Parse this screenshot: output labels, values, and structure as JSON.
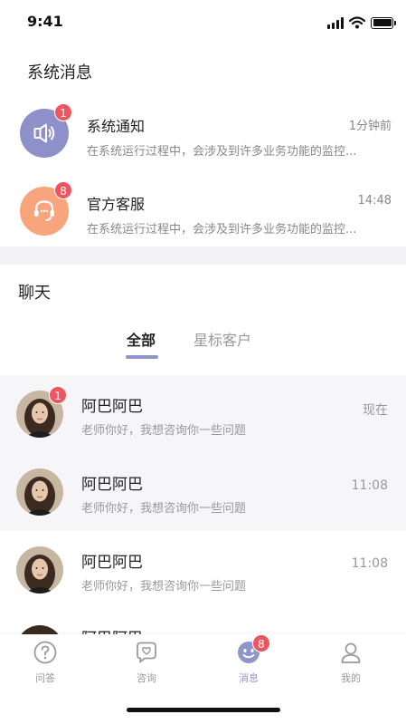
{
  "status_bar": {
    "time": "9:41",
    "icons": [
      "signal-icon",
      "wifi-icon",
      "battery-icon"
    ]
  },
  "system_section": {
    "title": "系统消息",
    "items": [
      {
        "name": "系统通知",
        "time": "1分钟前",
        "preview": "在系统运行过程中，会涉及到许多业务功能的监控...",
        "badge": "1",
        "icon": "speaker-icon",
        "color": "#8d90c9"
      },
      {
        "name": "官方客服",
        "time": "14:48",
        "preview": "在系统运行过程中，会涉及到许多业务功能的监控...",
        "badge": "8",
        "icon": "headset-icon",
        "color": "#f8a47c"
      }
    ]
  },
  "chat_section": {
    "title": "聊天",
    "tabs": [
      {
        "label": "全部",
        "active": true
      },
      {
        "label": "星标客户",
        "active": false
      }
    ],
    "items": [
      {
        "name": "阿巴阿巴",
        "preview": "老师你好，我想咨询你一些问题",
        "time": "现在",
        "badge": "1"
      },
      {
        "name": "阿巴阿巴",
        "preview": "老师你好，我想咨询你一些问题",
        "time": "11:08",
        "badge": ""
      },
      {
        "name": "阿巴阿巴",
        "preview": "老师你好，我想咨询你一些问题",
        "time": "11:08",
        "badge": ""
      },
      {
        "name": "阿巴阿巴",
        "preview": "",
        "time": "",
        "badge": ""
      }
    ]
  },
  "tab_bar": {
    "items": [
      {
        "label": "问答",
        "icon": "question-icon",
        "active": false,
        "badge": ""
      },
      {
        "label": "咨询",
        "icon": "chat-heart-icon",
        "active": false,
        "badge": ""
      },
      {
        "label": "消息",
        "icon": "message-face-icon",
        "active": true,
        "badge": "8"
      },
      {
        "label": "我的",
        "icon": "user-icon",
        "active": false,
        "badge": ""
      }
    ],
    "active_color": "#8f96c9",
    "badge_color": "#f0545f"
  }
}
